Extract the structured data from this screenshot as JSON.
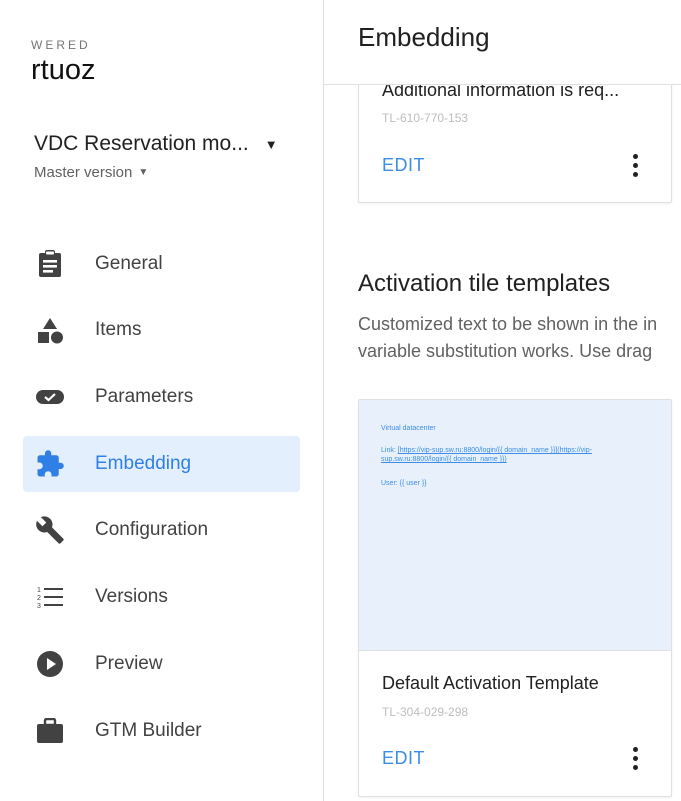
{
  "brand": {
    "top": "WERED",
    "name": "rtuoz"
  },
  "project": {
    "name": "VDC Reservation mo...",
    "version": "Master version"
  },
  "nav": [
    {
      "label": "General",
      "icon": "clipboard-icon"
    },
    {
      "label": "Items",
      "icon": "shapes-icon"
    },
    {
      "label": "Parameters",
      "icon": "toggle-check-icon"
    },
    {
      "label": "Embedding",
      "icon": "puzzle-icon",
      "active": true
    },
    {
      "label": "Configuration",
      "icon": "wrench-icon"
    },
    {
      "label": "Versions",
      "icon": "numbered-list-icon"
    },
    {
      "label": "Preview",
      "icon": "play-circle-icon"
    },
    {
      "label": "GTM Builder",
      "icon": "briefcase-icon"
    }
  ],
  "header": {
    "title": "Embedding"
  },
  "card_top": {
    "title": "Additional information is req...",
    "id": "TL-610-770-153",
    "edit": "EDIT"
  },
  "section": {
    "title": "Activation tile templates",
    "desc_line1": "Customized text to be shown in the in",
    "desc_line2": "variable substitution works. Use drag"
  },
  "card_template": {
    "preview_heading": "Virtual datacenter",
    "preview_link_label": "Link:",
    "preview_link": "[https://vip-sup.sw.ru:8800/login/{{ domain_name }}](https://vip-sup.sw.ru:8800/login/{{ domain_name }})",
    "preview_user": "User: {{ user }}",
    "title": "Default Activation Template",
    "id": "TL-304-029-298",
    "edit": "EDIT"
  },
  "colors": {
    "accent": "#2f7fe6",
    "active_bg": "#e3effd",
    "preview_bg": "#e8f1fb"
  }
}
